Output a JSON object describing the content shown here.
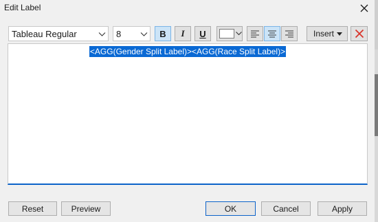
{
  "window": {
    "title": "Edit Label"
  },
  "toolbar": {
    "font": "Tableau Regular",
    "size": "8",
    "bold": "B",
    "italic": "I",
    "underline": "U",
    "text_color": "#ffffff",
    "insert_label": "Insert",
    "bold_active": true,
    "align_center_active": true
  },
  "editor": {
    "text": "<AGG(Gender Split Label)><AGG(Race Split Label)>"
  },
  "footer": {
    "reset": "Reset",
    "preview": "Preview",
    "ok": "OK",
    "cancel": "Cancel",
    "apply": "Apply"
  },
  "colors": {
    "selection": "#0a69d4",
    "focus_border": "#0b62c9",
    "clear_icon": "#d9342b"
  }
}
